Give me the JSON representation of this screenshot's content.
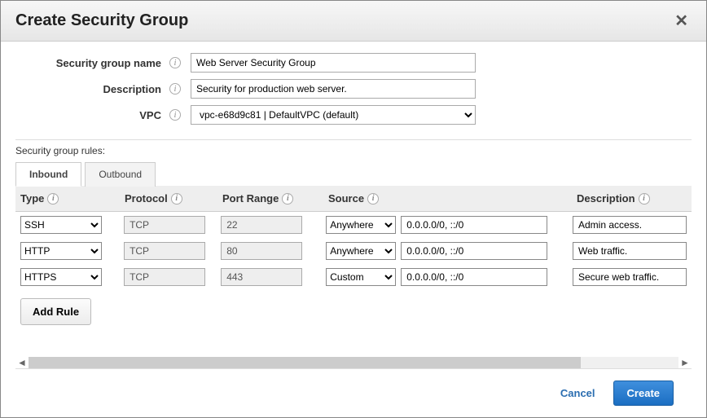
{
  "header": {
    "title": "Create Security Group"
  },
  "form": {
    "name_label": "Security group name",
    "name_value": "Web Server Security Group",
    "desc_label": "Description",
    "desc_value": "Security for production web server.",
    "vpc_label": "VPC",
    "vpc_value": "vpc-e68d9c81 | DefaultVPC (default)"
  },
  "rules_label": "Security group rules:",
  "tabs": {
    "inbound": "Inbound",
    "outbound": "Outbound"
  },
  "columns": {
    "type": "Type",
    "protocol": "Protocol",
    "port": "Port Range",
    "source": "Source",
    "description": "Description"
  },
  "rules": [
    {
      "type": "SSH",
      "protocol": "TCP",
      "port": "22",
      "source_sel": "Anywhere",
      "source_val": "0.0.0.0/0, ::/0",
      "desc": "Admin access."
    },
    {
      "type": "HTTP",
      "protocol": "TCP",
      "port": "80",
      "source_sel": "Anywhere",
      "source_val": "0.0.0.0/0, ::/0",
      "desc": "Web traffic."
    },
    {
      "type": "HTTPS",
      "protocol": "TCP",
      "port": "443",
      "source_sel": "Custom",
      "source_val": "0.0.0.0/0, ::/0",
      "desc": "Secure web traffic."
    }
  ],
  "add_rule_label": "Add Rule",
  "footer": {
    "cancel": "Cancel",
    "create": "Create"
  }
}
